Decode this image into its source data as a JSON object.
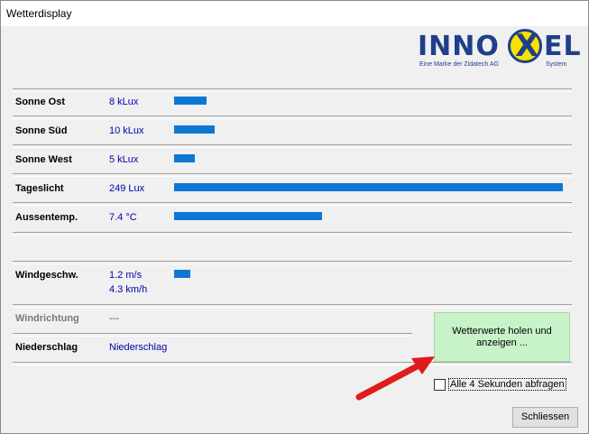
{
  "window": {
    "title": "Wetterdisplay"
  },
  "logo": {
    "brand_left": "INNO",
    "brand_x": "X",
    "brand_right": "EL",
    "tagline": "Eine Marke der Zidatech AG",
    "system": "System"
  },
  "rows": [
    {
      "label": "Sonne Ost",
      "value": "8 kLux",
      "bar_fraction": 0.084
    },
    {
      "label": "Sonne Süd",
      "value": "10 kLux",
      "bar_fraction": 0.105
    },
    {
      "label": "Sonne West",
      "value": "5 kLux",
      "bar_fraction": 0.053
    },
    {
      "label": "Tageslicht",
      "value": "249 Lux",
      "bar_fraction": 1.0
    },
    {
      "label": "Aussentemp.",
      "value": "7.4 °C",
      "bar_fraction": 0.381
    }
  ],
  "wind": {
    "label": "Windgeschw.",
    "value_ms": "1.2 m/s",
    "value_kmh": "4.3 km/h",
    "bar_fraction": 0.042
  },
  "direction": {
    "label": "Windrichtung",
    "value": "---"
  },
  "rain": {
    "label": "Niederschlag",
    "value": "Niederschlag"
  },
  "buttons": {
    "fetch": "Wetterwerte holen und anzeigen ...",
    "close": "Schliessen"
  },
  "checkbox": {
    "label": "Alle 4 Sekunden abfragen",
    "checked": false
  },
  "colors": {
    "bar": "#0d78d4",
    "value_text": "#0000aa",
    "fetch_button": "#c8f2c8",
    "arrow": "#e01b1b"
  }
}
